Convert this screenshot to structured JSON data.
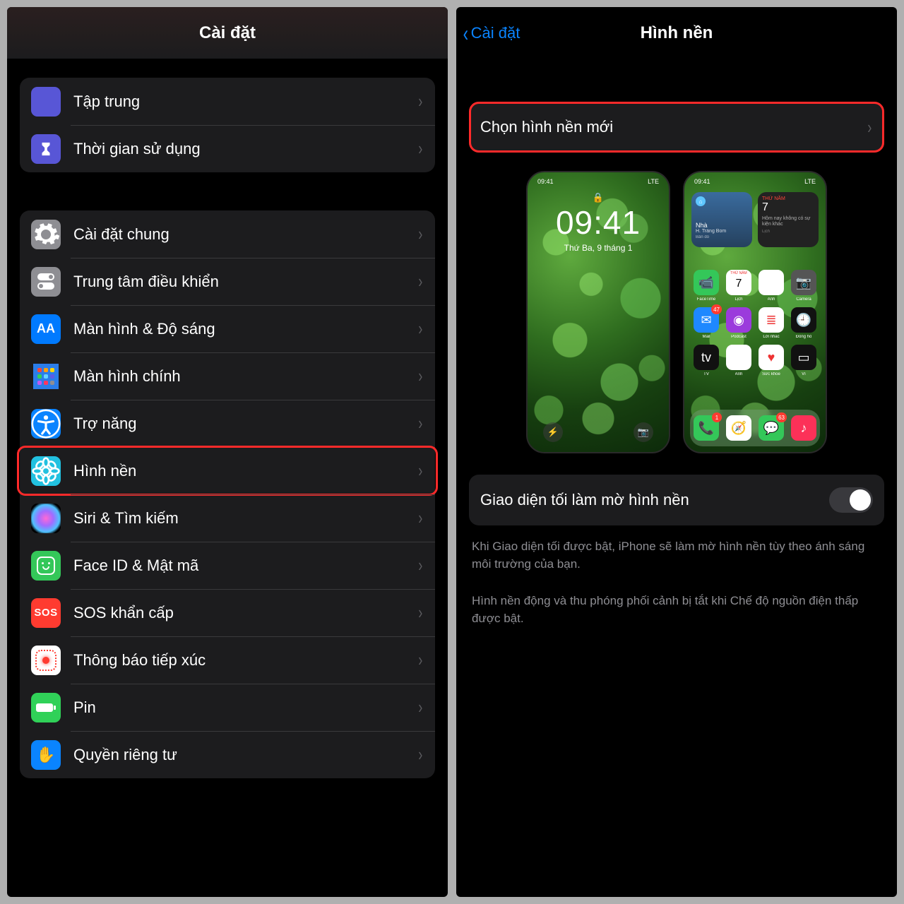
{
  "left": {
    "title": "Cài đặt",
    "group1": [
      {
        "id": "focus",
        "label": "Tập trung",
        "iconBg": "bg-purple",
        "glyph": "🌙"
      },
      {
        "id": "screentime",
        "label": "Thời gian sử dụng",
        "iconBg": "bg-purple",
        "glyph": "⌛"
      }
    ],
    "group2": [
      {
        "id": "general",
        "label": "Cài đặt chung",
        "iconBg": "bg-gray",
        "glyph": "gear"
      },
      {
        "id": "control-center",
        "label": "Trung tâm điều khiển",
        "iconBg": "bg-gray2",
        "glyph": "◎"
      },
      {
        "id": "display",
        "label": "Màn hình & Độ sáng",
        "iconBg": "bg-blue",
        "glyph": "AA"
      },
      {
        "id": "home-screen",
        "label": "Màn hình chính",
        "iconBg": "",
        "glyph": "grid"
      },
      {
        "id": "accessibility",
        "label": "Trợ năng",
        "iconBg": "bg-bluel",
        "glyph": "acc"
      },
      {
        "id": "wallpaper",
        "label": "Hình nền",
        "iconBg": "bg-cyan",
        "glyph": "flower",
        "highlight": true
      },
      {
        "id": "siri",
        "label": "Siri & Tìm kiếm",
        "iconBg": "siri-glow",
        "glyph": ""
      },
      {
        "id": "faceid",
        "label": "Face ID & Mật mã",
        "iconBg": "bg-green",
        "glyph": "🙂"
      },
      {
        "id": "sos",
        "label": "SOS khẩn cấp",
        "iconBg": "sos",
        "glyph": "SOS"
      },
      {
        "id": "exposure",
        "label": "Thông báo tiếp xúc",
        "iconBg": "expo",
        "glyph": "expo"
      },
      {
        "id": "battery",
        "label": "Pin",
        "iconBg": "bg-green2",
        "glyph": "bat"
      },
      {
        "id": "privacy",
        "label": "Quyền riêng tư",
        "iconBg": "bg-bluel",
        "glyph": "✋"
      }
    ]
  },
  "right": {
    "back": "Cài đặt",
    "title": "Hình nền",
    "choose": {
      "label": "Chọn hình nền mới"
    },
    "lockscreen": {
      "statusTime": "09:41",
      "statusCarrier": "LTE",
      "lock": "🔒",
      "time": "09:41",
      "date": "Thứ Ba, 9 tháng 1",
      "flash": "⚡",
      "camera": "📷"
    },
    "homescreen": {
      "statusTime": "09:41",
      "statusCarrier": "LTE",
      "widget1": {
        "title": "Nhà",
        "sub": "H. Trảng Bom",
        "sec": "Bản đồ"
      },
      "widget2": {
        "day": "THỨ NĂM",
        "num": "7",
        "text": "Hôm nay không có sự kiện khác",
        "sec": "Lịch"
      },
      "apps": [
        {
          "label": "FaceTime",
          "color": "#34c759",
          "glyph": "📹",
          "badge": ""
        },
        {
          "label": "Lịch",
          "color": "#ffffff",
          "glyph": "7",
          "badge": "",
          "textDark": true,
          "top": "THỨ NĂM"
        },
        {
          "label": "Ảnh",
          "color": "#ffffff",
          "glyph": "❖",
          "badge": ""
        },
        {
          "label": "Camera",
          "color": "#555555",
          "glyph": "📷",
          "badge": ""
        },
        {
          "label": "Mail",
          "color": "#1e88ff",
          "glyph": "✉",
          "badge": "47"
        },
        {
          "label": "Podcast",
          "color": "#9b3bdc",
          "glyph": "◉",
          "badge": ""
        },
        {
          "label": "Lời nhắc",
          "color": "#ffffff",
          "glyph": "≣",
          "badge": "",
          "textDark": true
        },
        {
          "label": "Đồng hồ",
          "color": "#111111",
          "glyph": "🕘",
          "badge": ""
        },
        {
          "label": "TV",
          "color": "#111111",
          "glyph": "tv",
          "badge": ""
        },
        {
          "label": "Ảnh",
          "color": "#ffffff",
          "glyph": "✿",
          "badge": ""
        },
        {
          "label": "Sức khỏe",
          "color": "#ffffff",
          "glyph": "♥",
          "badge": "",
          "textDark": true
        },
        {
          "label": "Ví",
          "color": "#111111",
          "glyph": "▭",
          "badge": ""
        }
      ],
      "dock": [
        {
          "color": "#34c759",
          "glyph": "📞",
          "badge": "1"
        },
        {
          "color": "#ffffff",
          "glyph": "🧭"
        },
        {
          "color": "#34c759",
          "glyph": "💬",
          "badge": "63"
        },
        {
          "color": "#fc3158",
          "glyph": "♪"
        }
      ]
    },
    "toggle": {
      "label": "Giao diện tối làm mờ hình nền",
      "on": false
    },
    "note1": "Khi Giao diện tối được bật, iPhone sẽ làm mờ hình nền tùy theo ánh sáng môi trường của bạn.",
    "note2": "Hình nền động và thu phóng phối cảnh bị tắt khi Chế độ nguồn điện thấp được bật."
  }
}
